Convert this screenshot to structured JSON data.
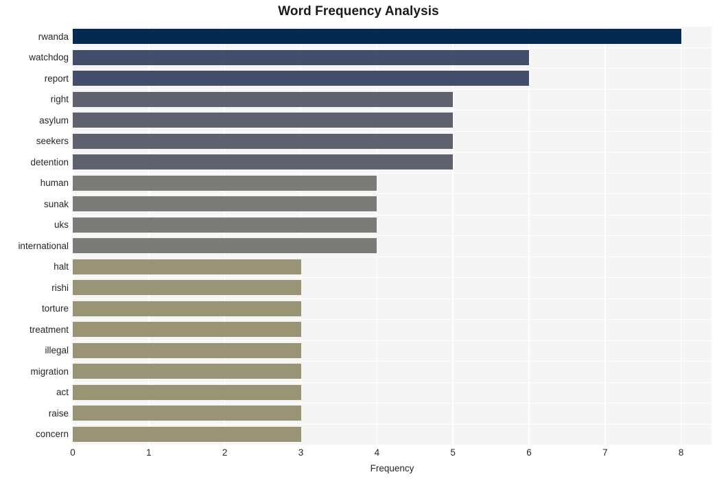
{
  "chart_data": {
    "type": "bar",
    "orientation": "horizontal",
    "title": "Word Frequency Analysis",
    "xlabel": "Frequency",
    "ylabel": "",
    "categories": [
      "rwanda",
      "watchdog",
      "report",
      "right",
      "asylum",
      "seekers",
      "detention",
      "human",
      "sunak",
      "uks",
      "international",
      "halt",
      "rishi",
      "torture",
      "treatment",
      "illegal",
      "migration",
      "act",
      "raise",
      "concern"
    ],
    "values": [
      8,
      6,
      6,
      5,
      5,
      5,
      5,
      4,
      4,
      4,
      4,
      3,
      3,
      3,
      3,
      3,
      3,
      3,
      3,
      3
    ],
    "xlim": [
      0,
      8.4
    ],
    "xticks": [
      0,
      1,
      2,
      3,
      4,
      5,
      6,
      7,
      8
    ],
    "xtick_labels": [
      "0",
      "1",
      "2",
      "3",
      "4",
      "5",
      "6",
      "7",
      "8"
    ],
    "grid": true,
    "grid_color": "#ffffff",
    "plot_background": "#f5f5f6",
    "figure_background": "#ffffff",
    "legend": null,
    "bar_colors": [
      "#042a4f",
      "#434e6a",
      "#434e6a",
      "#5d626e",
      "#5d626e",
      "#5d626e",
      "#5d626e",
      "#7b7b77",
      "#7b7b77",
      "#7b7b77",
      "#7b7b77",
      "#9a9477",
      "#9a9477",
      "#9a9477",
      "#9a9477",
      "#9a9477",
      "#9a9477",
      "#9a9477",
      "#9a9477",
      "#9a9477"
    ]
  }
}
